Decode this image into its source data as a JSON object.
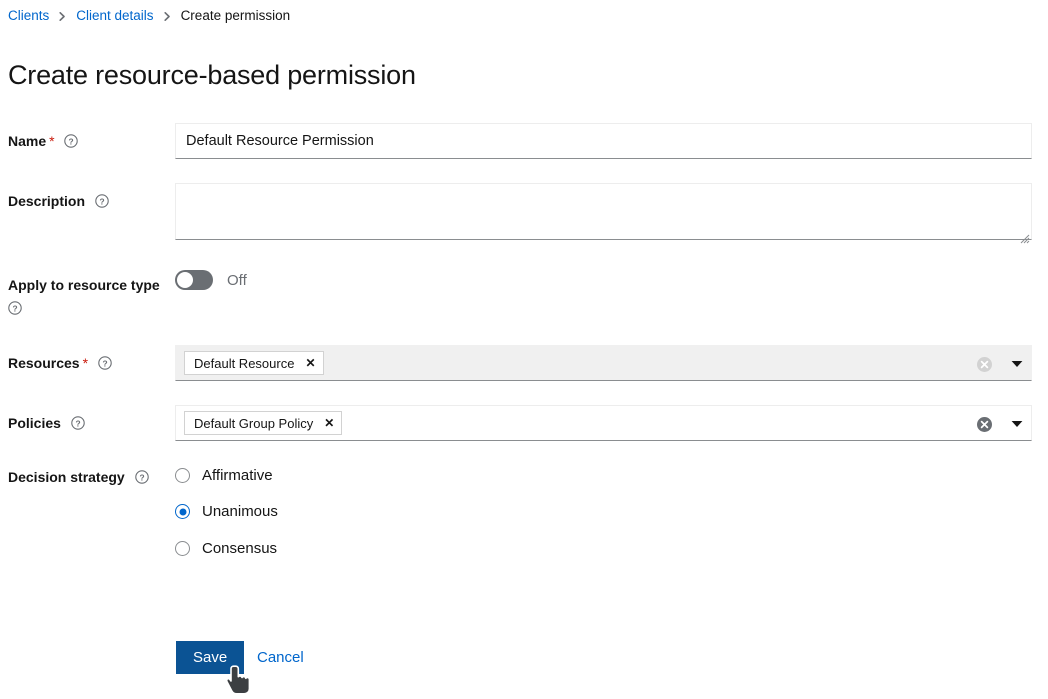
{
  "breadcrumb": {
    "items": [
      {
        "label": "Clients",
        "link": true
      },
      {
        "label": "Client details",
        "link": true
      },
      {
        "label": "Create permission",
        "link": false
      }
    ]
  },
  "page_title": "Create resource-based permission",
  "form": {
    "name": {
      "label": "Name",
      "required_marker": "*",
      "value": "Default Resource Permission",
      "placeholder": ""
    },
    "description": {
      "label": "Description",
      "value": "",
      "placeholder": ""
    },
    "apply_to_resource_type": {
      "label": "Apply to resource type",
      "state_label": "Off",
      "checked": false
    },
    "resources": {
      "label": "Resources",
      "required_marker": "*",
      "chips": [
        {
          "label": "Default Resource",
          "remove_label": "✕"
        }
      ],
      "disabled": true
    },
    "policies": {
      "label": "Policies",
      "chips": [
        {
          "label": "Default Group Policy",
          "remove_label": "✕"
        }
      ],
      "disabled": false
    },
    "decision_strategy": {
      "label": "Decision strategy",
      "options": [
        {
          "label": "Affirmative",
          "selected": false
        },
        {
          "label": "Unanimous",
          "selected": true
        },
        {
          "label": "Consensus",
          "selected": false
        }
      ]
    }
  },
  "actions": {
    "save_label": "Save",
    "cancel_label": "Cancel"
  },
  "colors": {
    "link": "#0066cc",
    "primary_button": "#0b5394",
    "required": "#c9190b",
    "switch_off": "#6a6e73",
    "radio_selected": "#0066cc"
  }
}
